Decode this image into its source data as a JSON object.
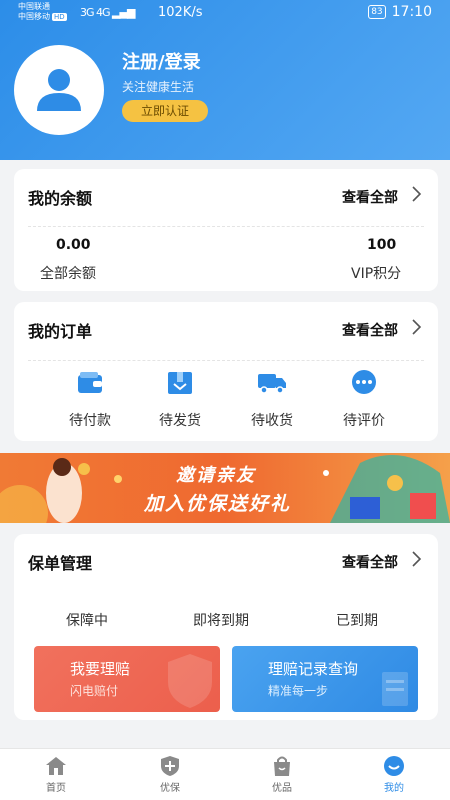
{
  "status_bar": {
    "carrier1": "中国联通",
    "carrier2": "中国移动",
    "hd": "HD",
    "signal": "3G 4G",
    "speed": "102K/s",
    "battery": "83",
    "time": "17:10"
  },
  "user": {
    "title": "注册/登录",
    "subtitle": "关注健康生活",
    "verify_label": "立即认证"
  },
  "balance": {
    "title": "我的余额",
    "more": "查看全部",
    "total_value": "0.00",
    "total_label": "全部余额",
    "vip_value": "100",
    "vip_label": "VIP积分"
  },
  "orders": {
    "title": "我的订单",
    "more": "查看全部",
    "items": [
      {
        "label": "待付款",
        "icon": "wallet-icon"
      },
      {
        "label": "待发货",
        "icon": "box-icon"
      },
      {
        "label": "待收货",
        "icon": "truck-icon"
      },
      {
        "label": "待评价",
        "icon": "comment-icon"
      }
    ]
  },
  "banner": {
    "line1": "邀请亲友",
    "line2": "加入优保送好礼"
  },
  "policy": {
    "title": "保单管理",
    "more": "查看全部",
    "tabs": [
      "保障中",
      "即将到期",
      "已到期"
    ],
    "claim": {
      "title": "我要理赔",
      "subtitle": "闪电赔付"
    },
    "records": {
      "title": "理赔记录查询",
      "subtitle": "精准每一步"
    }
  },
  "tabbar": {
    "items": [
      {
        "label": "首页",
        "icon": "home-icon"
      },
      {
        "label": "优保",
        "icon": "shield-plus-icon"
      },
      {
        "label": "优品",
        "icon": "shopping-bag-icon"
      },
      {
        "label": "我的",
        "icon": "profile-smile-icon"
      }
    ],
    "active": "我的"
  },
  "colors": {
    "primary": "#2e8ce6",
    "accent_yellow": "#f5c242",
    "claim_red": "#ef6a55",
    "records_blue": "#3d98ea"
  }
}
